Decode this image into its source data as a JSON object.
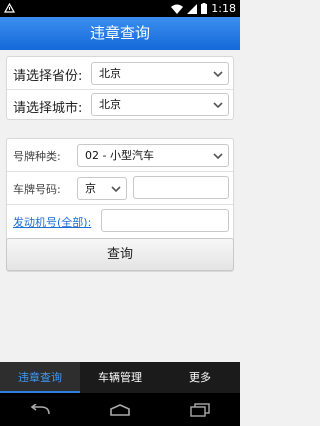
{
  "status_bar": {
    "time": "1:18"
  },
  "header": {
    "title": "违章查询"
  },
  "location": {
    "province_label": "请选择省份:",
    "province_value": "北京",
    "city_label": "请选择城市:",
    "city_value": "北京"
  },
  "vehicle": {
    "plate_type_label": "号牌种类:",
    "plate_type_value": "02 - 小型汽车",
    "plate_number_label": "车牌号码:",
    "plate_prefix_value": "京",
    "plate_number_value": "",
    "engine_label": "发动机号(全部):",
    "engine_value": ""
  },
  "actions": {
    "query_label": "查询"
  },
  "tabs": [
    {
      "label": "违章查询",
      "active": true
    },
    {
      "label": "车辆管理",
      "active": false
    },
    {
      "label": "更多",
      "active": false
    }
  ],
  "colors": {
    "header": "#1f76e0",
    "active_tab_text": "#3d9bf5",
    "link": "#1a6ed8"
  },
  "icons": {
    "status_left": "android-debug-icon",
    "wifi": "wifi-icon",
    "signal": "signal-icon",
    "battery": "battery-icon",
    "back": "back-icon",
    "home": "home-icon",
    "recents": "recent-apps-icon"
  }
}
